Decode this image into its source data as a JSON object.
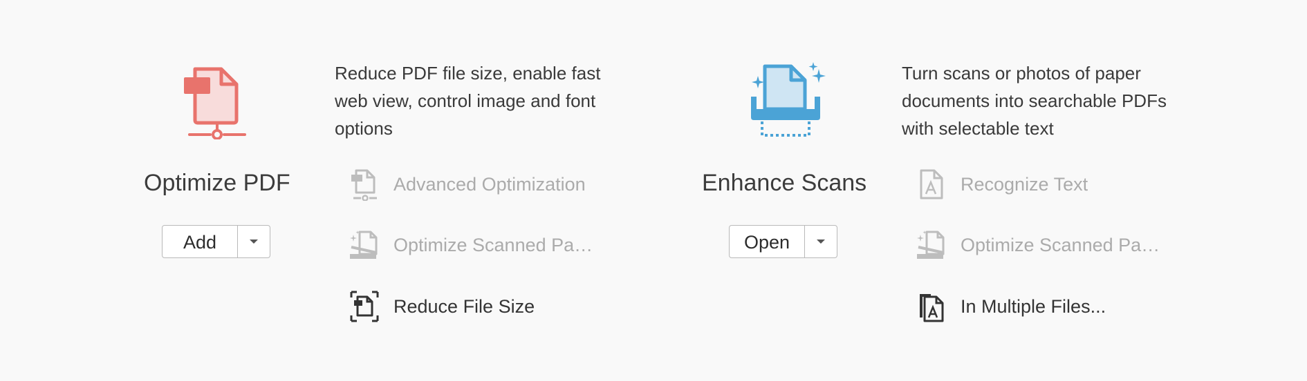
{
  "tools": [
    {
      "name": "Optimize PDF",
      "icon": "optimize-pdf-icon",
      "button_label": "Add",
      "description": "Reduce PDF file size, enable fast web view, control image and font options",
      "features": [
        {
          "label": "Advanced Optimization",
          "icon": "advanced-optimization-icon",
          "enabled": false
        },
        {
          "label": "Optimize Scanned Pa…",
          "icon": "optimize-scanned-pages-icon",
          "enabled": false
        },
        {
          "label": "Reduce File Size",
          "icon": "reduce-file-size-icon",
          "enabled": true
        }
      ]
    },
    {
      "name": "Enhance Scans",
      "icon": "enhance-scans-icon",
      "button_label": "Open",
      "description": "Turn scans or photos of paper documents into searchable PDFs with selectable text",
      "features": [
        {
          "label": "Recognize Text",
          "icon": "recognize-text-icon",
          "enabled": false
        },
        {
          "label": "Optimize Scanned Pa…",
          "icon": "optimize-scanned-pages-icon",
          "enabled": false
        },
        {
          "label": "In Multiple Files...",
          "icon": "multiple-files-icon",
          "enabled": true
        }
      ]
    }
  ],
  "colors": {
    "optimize_accent": "#e8736c",
    "enhance_accent": "#4ba3d6",
    "disabled_text": "#ababab",
    "enabled_text": "#333333"
  }
}
